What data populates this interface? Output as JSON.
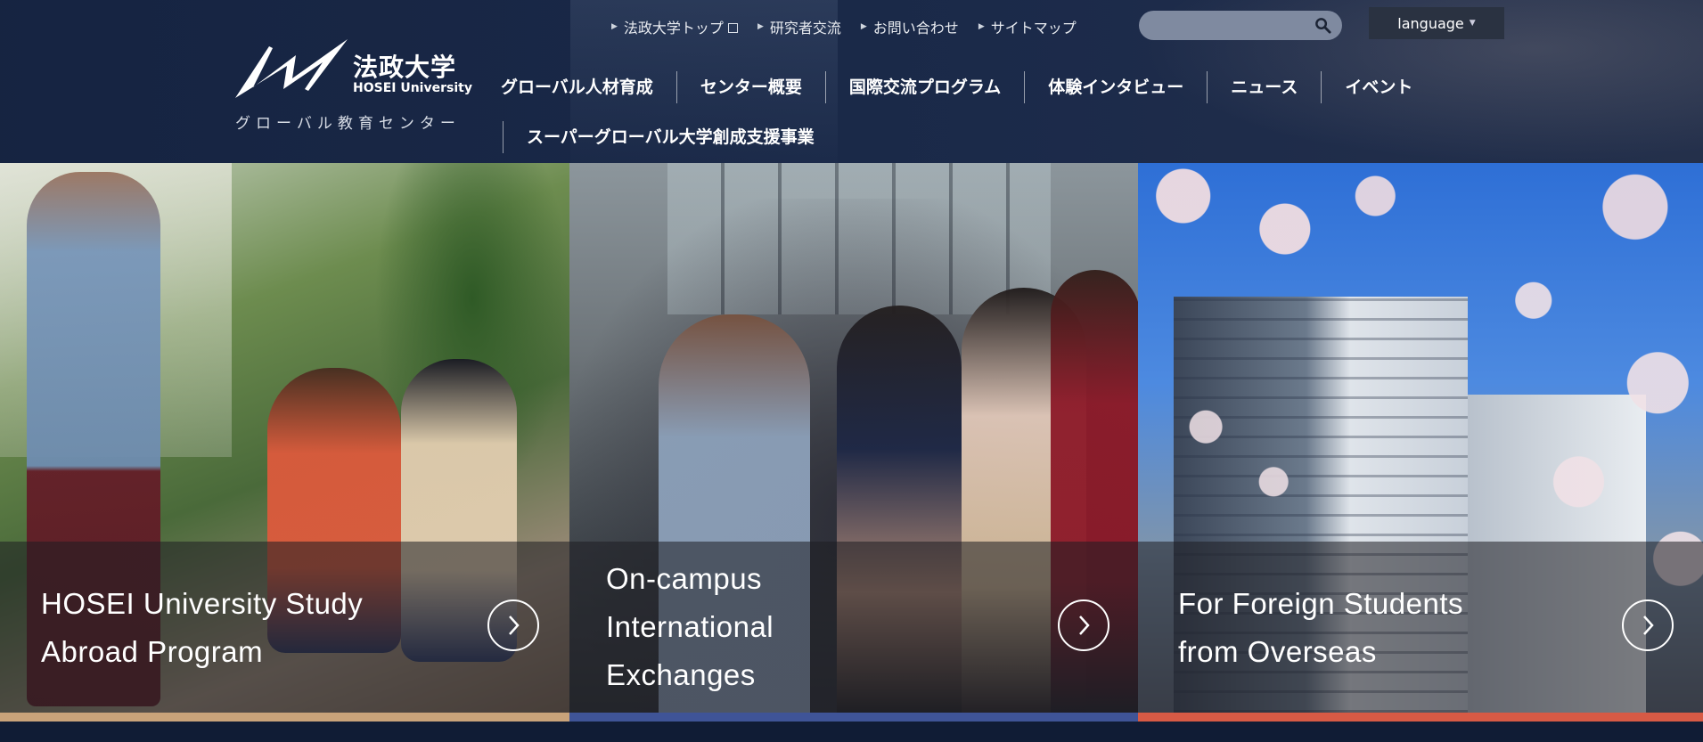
{
  "header": {
    "logo": {
      "jp": "法政大学",
      "en": "HOSEI University",
      "subtitle": "グローバル教育センター"
    },
    "top_links": [
      {
        "label": "法政大学トップ",
        "external": true
      },
      {
        "label": "研究者交流",
        "external": false
      },
      {
        "label": "お問い合わせ",
        "external": false
      },
      {
        "label": "サイトマップ",
        "external": false
      }
    ],
    "search": {
      "placeholder": "",
      "icon": "search-icon"
    },
    "language": {
      "label": "language"
    },
    "global_nav": [
      "グローバル人材育成",
      "センター概要",
      "国際交流プログラム",
      "体験インタビュー",
      "ニュース",
      "イベント"
    ],
    "global_nav_row2": "スーパーグローバル大学創成支援事業"
  },
  "panels": [
    {
      "title": "HOSEI University Study\nAbroad Program",
      "accent": "#c9a37a"
    },
    {
      "title": "On-campus\nInternational\nExchanges",
      "accent": "#3f5497"
    },
    {
      "title": "For Foreign Students\nfrom Overseas",
      "accent": "#d75a45"
    }
  ],
  "colors": {
    "header_bg": "#1c2b4b",
    "language_bg": "#2a3241",
    "search_bg": "#7f8aa0"
  }
}
